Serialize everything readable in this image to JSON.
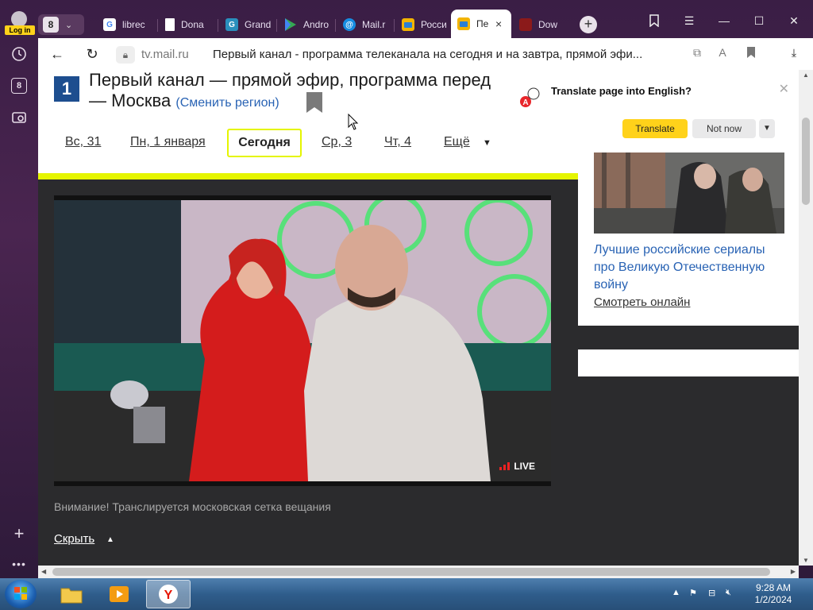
{
  "sidebar": {
    "login_label": "Log in",
    "tabs_count": "8"
  },
  "tabstrip": {
    "count": "8",
    "tabs": [
      {
        "title": "librec",
        "icon": "google-icon",
        "color": "#ffffff"
      },
      {
        "title": "Dona",
        "icon": "document-icon",
        "color": "#ffffff"
      },
      {
        "title": "Grand",
        "icon": "grand-icon",
        "color": "#2a8fbd"
      },
      {
        "title": "Andro",
        "icon": "play-store-icon",
        "color": "#34a853"
      },
      {
        "title": "Mail.r",
        "icon": "mail-ru-icon",
        "color": "#168de2"
      },
      {
        "title": "Росси",
        "icon": "tv-icon",
        "color": "#2a7fd4"
      },
      {
        "title": "Пе",
        "icon": "tv-icon",
        "color": "#2a7fd4",
        "active": true
      },
      {
        "title": "Dow",
        "icon": "download-site-icon",
        "color": "#8b1a1a"
      }
    ]
  },
  "addressbar": {
    "domain": "tv.mail.ru",
    "title": "Первый канал - программа телеканала на сегодня и на завтра, прямой эфи..."
  },
  "page": {
    "logo_text": "1",
    "heading_line1": "Первый канал — прямой эфир, программа перед",
    "heading_line2": "— Москва",
    "region_link": "(Сменить регион)",
    "days": [
      "Вс, 31",
      "Пн, 1 января",
      "Сегодня",
      "Ср, 3",
      "Чт, 4",
      "Ещё"
    ],
    "live_label": "LIVE",
    "warning": "Внимание! Транслируется московская сетка вещания",
    "hide_label": "Скрыть"
  },
  "rightcol": {
    "card_title": "Лучшие российские сериалы про Великую Отечественную войну",
    "card_link": "Смотреть онлайн"
  },
  "translate": {
    "title": "Translate page into English?",
    "translate_btn": "Translate",
    "notnow_btn": "Not now"
  },
  "taskbar": {
    "time": "9:28 AM",
    "date": "1/2/2024"
  },
  "colors": {
    "accent_yellow": "#ffd21a",
    "site_yellow": "#e5f500",
    "link_blue": "#2963b4",
    "channel_blue": "#1d4e8f"
  }
}
